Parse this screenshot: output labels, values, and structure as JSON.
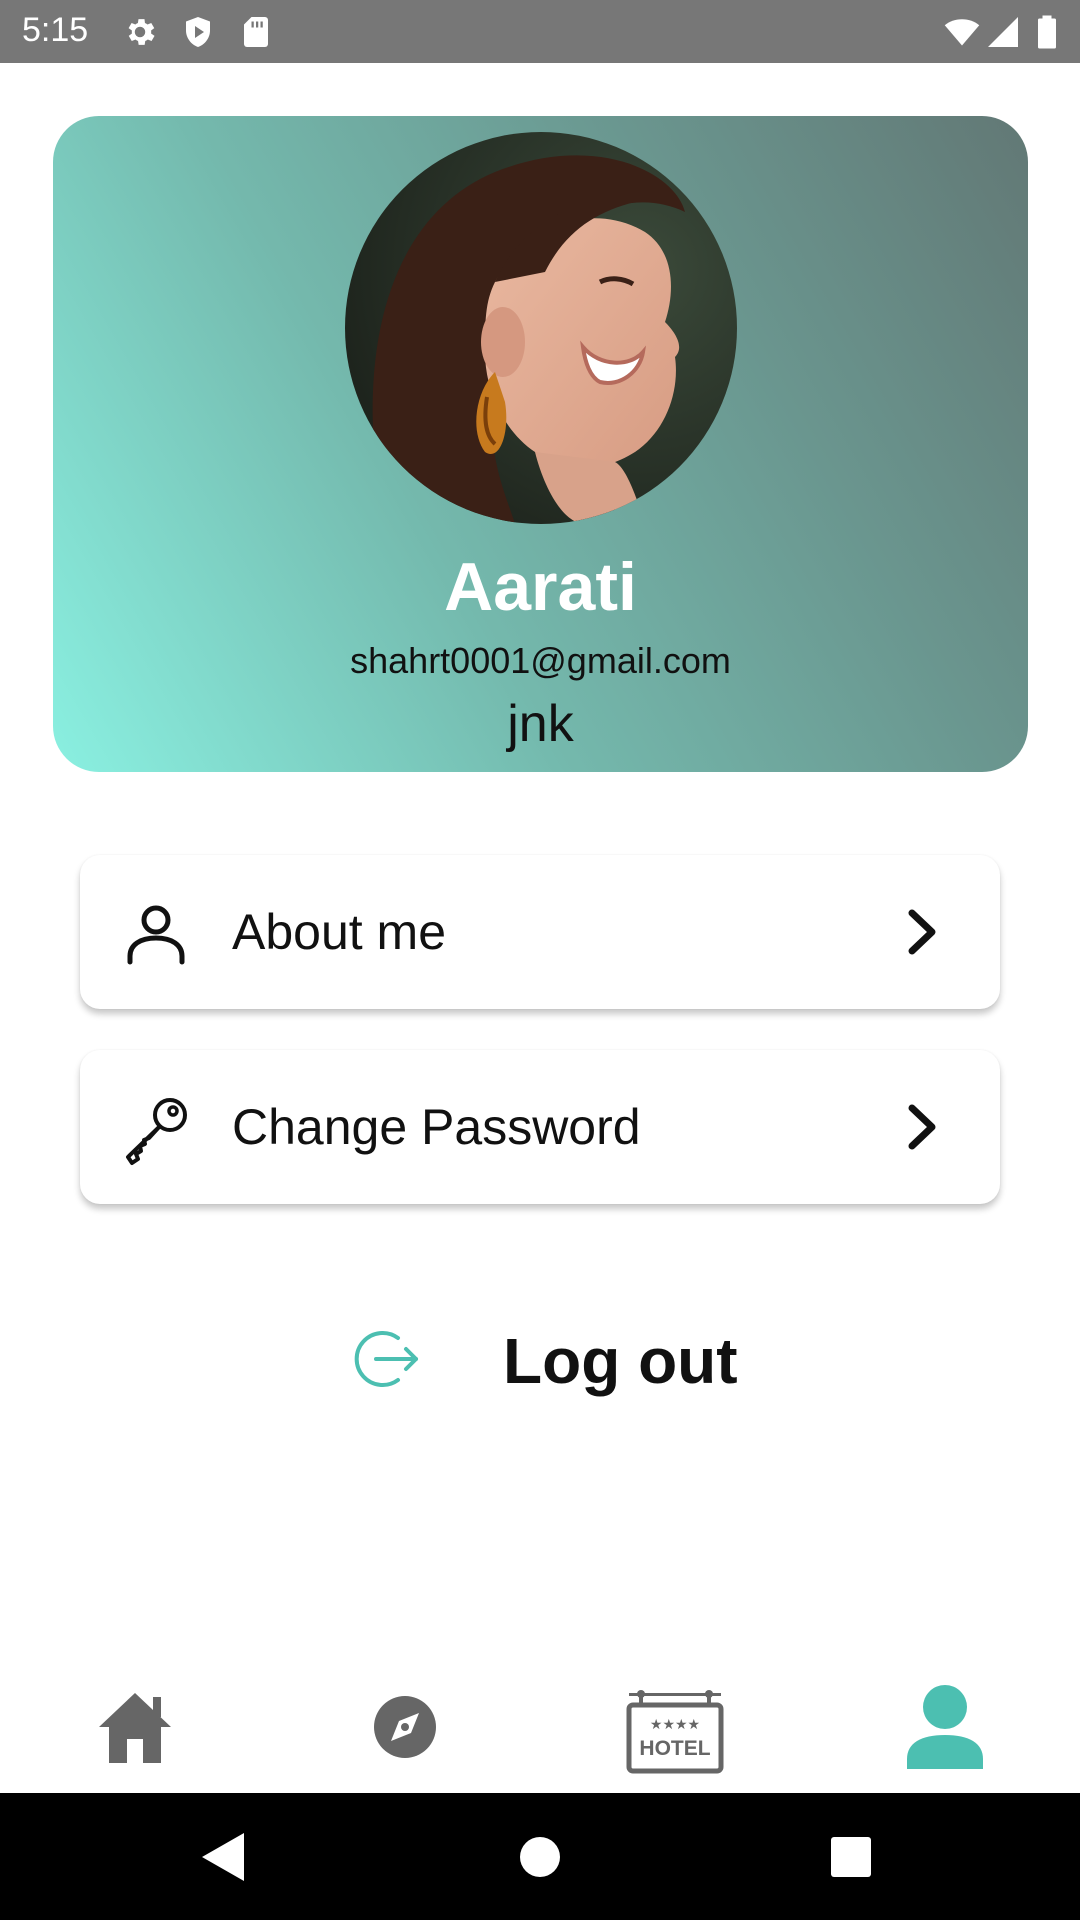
{
  "status_bar": {
    "time": "5:15",
    "left_icons": [
      "gear-icon",
      "shield-icon",
      "sd-card-icon"
    ],
    "right_icons": [
      "wifi-icon",
      "cell-signal-icon",
      "battery-icon"
    ]
  },
  "profile": {
    "name": "Aarati",
    "email": "shahrt0001@gmail.com",
    "extra": "jnk",
    "avatar": "profile-photo",
    "card_gradient": [
      "#8af0e1",
      "#627875"
    ]
  },
  "menu": [
    {
      "label": "About me",
      "icon": "person-icon"
    },
    {
      "label": "Change Password",
      "icon": "key-icon"
    }
  ],
  "logout": {
    "label": "Log out",
    "icon": "logout-icon",
    "icon_color": "#4cbfb1"
  },
  "bottom_nav": [
    {
      "name": "home",
      "icon": "home-icon",
      "active": false
    },
    {
      "name": "explore",
      "icon": "compass-icon",
      "active": false
    },
    {
      "name": "hotel",
      "icon": "hotel-sign-icon",
      "active": false,
      "badge_text": "HOTEL"
    },
    {
      "name": "profile",
      "icon": "person-icon",
      "active": true
    }
  ],
  "colors": {
    "accent": "#4cbfb1",
    "inactive": "#666666"
  }
}
